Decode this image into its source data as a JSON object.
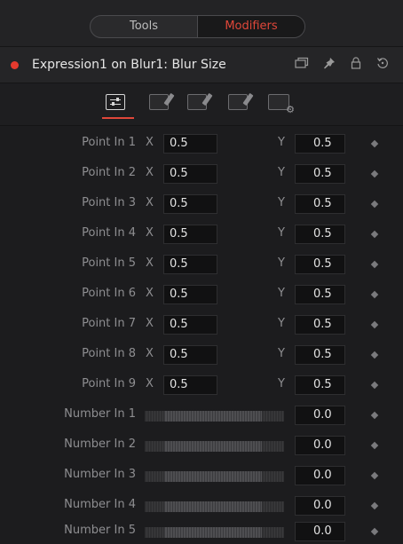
{
  "tabs": {
    "tools": "Tools",
    "modifiers": "Modifiers"
  },
  "header": {
    "title": "Expression1 on Blur1: Blur Size"
  },
  "axis": {
    "x": "X",
    "y": "Y"
  },
  "points": [
    {
      "label": "Point In 1",
      "x": "0.5",
      "y": "0.5"
    },
    {
      "label": "Point In 2",
      "x": "0.5",
      "y": "0.5"
    },
    {
      "label": "Point In 3",
      "x": "0.5",
      "y": "0.5"
    },
    {
      "label": "Point In 4",
      "x": "0.5",
      "y": "0.5"
    },
    {
      "label": "Point In 5",
      "x": "0.5",
      "y": "0.5"
    },
    {
      "label": "Point In 6",
      "x": "0.5",
      "y": "0.5"
    },
    {
      "label": "Point In 7",
      "x": "0.5",
      "y": "0.5"
    },
    {
      "label": "Point In 8",
      "x": "0.5",
      "y": "0.5"
    },
    {
      "label": "Point In 9",
      "x": "0.5",
      "y": "0.5"
    }
  ],
  "numbers": [
    {
      "label": "Number In 1",
      "value": "0.0"
    },
    {
      "label": "Number In 2",
      "value": "0.0"
    },
    {
      "label": "Number In 3",
      "value": "0.0"
    },
    {
      "label": "Number In 4",
      "value": "0.0"
    },
    {
      "label": "Number In 5",
      "value": "0.0"
    }
  ],
  "colors": {
    "accent": "#e0473a",
    "record": "#e53a2e"
  }
}
